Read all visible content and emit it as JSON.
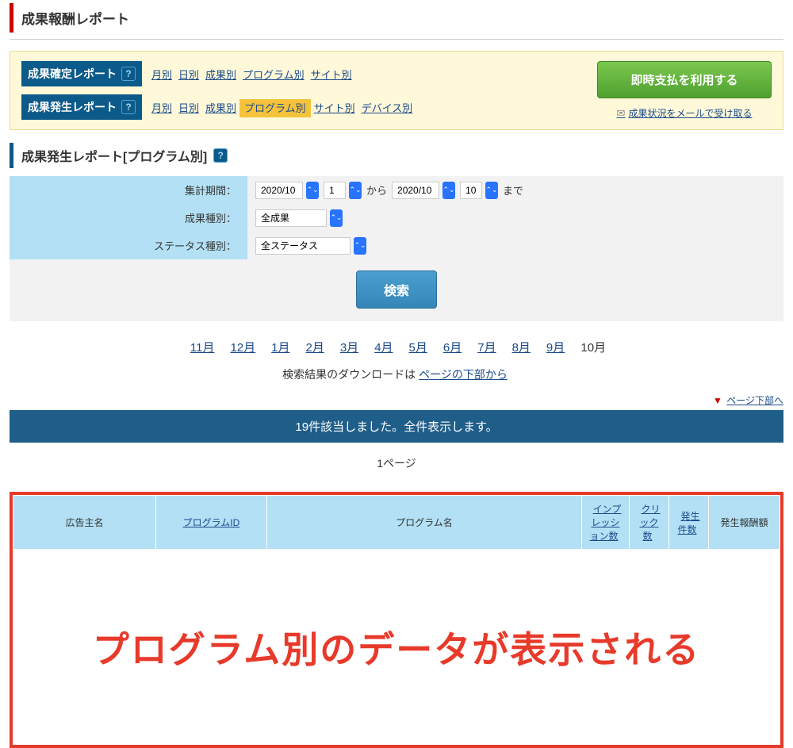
{
  "pageTitle": "成果報酬レポート",
  "help": "?",
  "confirmReport": {
    "label": "成果確定レポート",
    "links": [
      "月別",
      "日別",
      "成果別",
      "プログラム別",
      "サイト別"
    ]
  },
  "occurReport": {
    "label": "成果発生レポート",
    "links": [
      "月別",
      "日別",
      "成果別",
      "プログラム別",
      "サイト別",
      "デバイス別"
    ],
    "activeIndex": 3
  },
  "greenBtn": "即時支払を利用する",
  "mailLink": "成果状況をメールで受け取る",
  "sectionTitle": "成果発生レポート[プログラム別]",
  "form": {
    "periodLabel": "集計期間：",
    "ym1": "2020/10",
    "d1": "1",
    "kara": "から",
    "ym2": "2020/10",
    "d2": "10",
    "made": "まで",
    "typeLabel": "成果種別：",
    "typeVal": "全成果",
    "statusLabel": "ステータス種別：",
    "statusVal": "全ステータス"
  },
  "searchBtn": "検索",
  "months": [
    "11月",
    "12月",
    "1月",
    "2月",
    "3月",
    "4月",
    "5月",
    "6月",
    "7月",
    "8月",
    "9月"
  ],
  "currentMonth": "10月",
  "downloadPrefix": "検索結果のダウンロードは",
  "downloadLink": "ページの下部から",
  "bottomLink": "ページ下部へ",
  "resultBar": "19件該当しました。全件表示します。",
  "pageNo": "1ページ",
  "headers": {
    "advertiser": "広告主名",
    "programId": "プログラムID",
    "programName": "プログラム名",
    "impressions": "インプレッション数",
    "clicks": "クリック数",
    "count": "発生件数",
    "reward": "発生報酬額"
  },
  "overlayText": "プログラム別のデータが表示される"
}
